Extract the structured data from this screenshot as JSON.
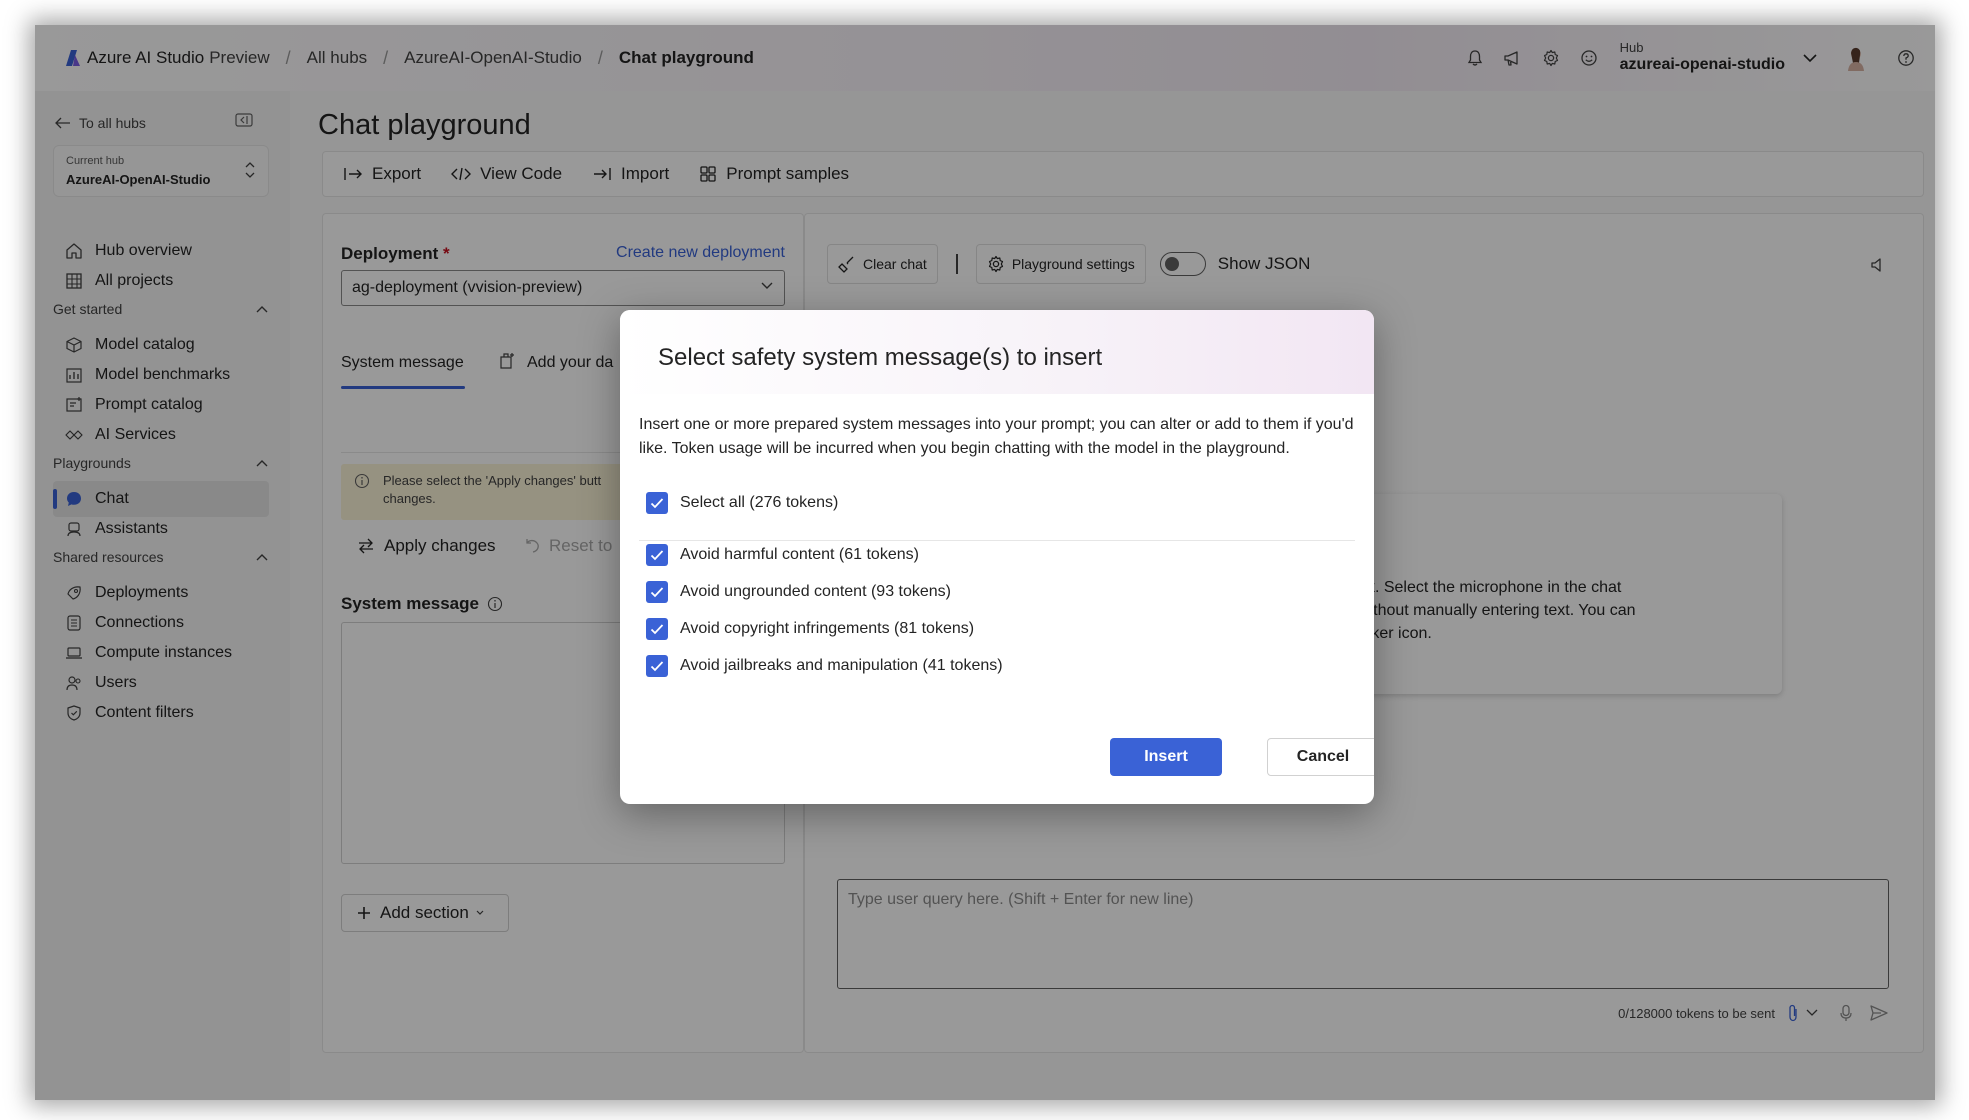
{
  "header": {
    "brand_name": "Azure AI Studio",
    "brand_suffix": "Preview",
    "breadcrumbs": [
      "All hubs",
      "AzureAI-OpenAI-Studio",
      "Chat playground"
    ],
    "hub_label": "Hub",
    "hub_name": "azureai-openai-studio",
    "icons": [
      "bell-icon",
      "megaphone-icon",
      "gear-icon",
      "smiley-icon",
      "chevron-down-icon",
      "avatar",
      "help-icon"
    ]
  },
  "sidebar": {
    "back_label": "To all hubs",
    "current_hub_label": "Current hub",
    "current_hub_value": "AzureAI-OpenAI-Studio",
    "top_items": [
      {
        "label": "Hub overview",
        "icon": "home-icon"
      },
      {
        "label": "All projects",
        "icon": "grid-icon"
      }
    ],
    "sections": [
      {
        "title": "Get started",
        "items": [
          {
            "label": "Model catalog",
            "icon": "cube-icon"
          },
          {
            "label": "Model benchmarks",
            "icon": "benchmark-icon"
          },
          {
            "label": "Prompt catalog",
            "icon": "prompt-icon"
          },
          {
            "label": "AI Services",
            "icon": "services-icon"
          }
        ]
      },
      {
        "title": "Playgrounds",
        "items": [
          {
            "label": "Chat",
            "icon": "chat-icon",
            "active": true
          },
          {
            "label": "Assistants",
            "icon": "assistant-icon"
          }
        ]
      },
      {
        "title": "Shared resources",
        "items": [
          {
            "label": "Deployments",
            "icon": "deploy-icon"
          },
          {
            "label": "Connections",
            "icon": "connection-icon"
          },
          {
            "label": "Compute instances",
            "icon": "laptop-icon"
          },
          {
            "label": "Users",
            "icon": "users-icon"
          },
          {
            "label": "Content filters",
            "icon": "shield-icon"
          }
        ]
      }
    ]
  },
  "page": {
    "title": "Chat playground",
    "toolbar": {
      "export": "Export",
      "view_code": "View Code",
      "import": "Import",
      "prompt_samples": "Prompt samples"
    }
  },
  "setup": {
    "deployment_label": "Deployment",
    "required_mark": "*",
    "create_link": "Create new deployment",
    "deployment_value": "ag-deployment (vvision-preview)",
    "tab_system": "System message",
    "tab_data": "Add your da",
    "info_text_1": "Please select the 'Apply changes' butt",
    "info_text_2": "changes.",
    "apply_label": "Apply changes",
    "reset_label": "Reset to",
    "sysmsg_label": "System message",
    "add_section_label": "Add section"
  },
  "chat": {
    "clear_chat": "Clear chat",
    "playground_settings": "Playground settings",
    "show_json": "Show JSON",
    "show_json_on": false,
    "card_lines": [
      "nd speak. Select the microphone in the chat",
      "model without manually entering text. You can",
      "the speaker icon."
    ],
    "query_placeholder": "Type user query here. (Shift + Enter for new line)",
    "token_count": "0/128000 tokens to be sent"
  },
  "dialog": {
    "title": "Select safety system message(s) to insert",
    "description": "Insert one or more prepared system messages into your prompt; you can alter or add to them if you'd like. Token usage will be incurred when you begin chatting with the model in the playground.",
    "select_all": "Select all (276 tokens)",
    "options": [
      {
        "label": "Avoid harmful content (61 tokens)",
        "checked": true
      },
      {
        "label": "Avoid ungrounded content (93 tokens)",
        "checked": true
      },
      {
        "label": "Avoid copyright infringements (81 tokens)",
        "checked": true
      },
      {
        "label": "Avoid jailbreaks and manipulation (41 tokens)",
        "checked": true
      }
    ],
    "insert_label": "Insert",
    "cancel_label": "Cancel"
  },
  "colors": {
    "accent": "#3a62d6",
    "overlay": "rgba(0,0,0,0.40)",
    "info_bar": "#fbf3d8"
  }
}
